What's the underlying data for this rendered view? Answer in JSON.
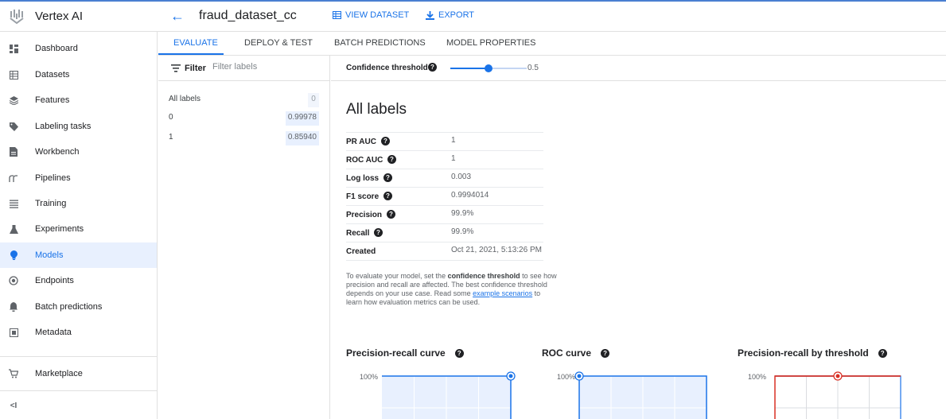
{
  "app": {
    "name": "Vertex AI"
  },
  "header": {
    "back_glyph": "←",
    "model_name": "fraud_dataset_cc",
    "view_dataset_label": "VIEW DATASET",
    "export_label": "EXPORT"
  },
  "sidebar": {
    "items": [
      {
        "label": "Dashboard",
        "icon": "dashboard-icon",
        "active": false
      },
      {
        "label": "Datasets",
        "icon": "datasets-icon",
        "active": false
      },
      {
        "label": "Features",
        "icon": "features-icon",
        "active": false
      },
      {
        "label": "Labeling tasks",
        "icon": "label-tag-icon",
        "active": false
      },
      {
        "label": "Workbench",
        "icon": "notebook-icon",
        "active": false
      },
      {
        "label": "Pipelines",
        "icon": "pipelines-icon",
        "active": false
      },
      {
        "label": "Training",
        "icon": "training-icon",
        "active": false
      },
      {
        "label": "Experiments",
        "icon": "flask-icon",
        "active": false
      },
      {
        "label": "Models",
        "icon": "lightbulb-icon",
        "active": true
      },
      {
        "label": "Endpoints",
        "icon": "endpoints-icon",
        "active": false
      },
      {
        "label": "Batch predictions",
        "icon": "bell-icon",
        "active": false
      },
      {
        "label": "Metadata",
        "icon": "metadata-icon",
        "active": false
      }
    ],
    "marketplace_label": "Marketplace",
    "collapse_glyph": "<I"
  },
  "tabs": [
    {
      "label": "EVALUATE",
      "active": true
    },
    {
      "label": "DEPLOY & TEST",
      "active": false
    },
    {
      "label": "BATCH PREDICTIONS",
      "active": false
    },
    {
      "label": "MODEL PROPERTIES",
      "active": false
    }
  ],
  "filter": {
    "label": "Filter",
    "placeholder": "Filter labels"
  },
  "labels": [
    {
      "name": "All labels",
      "value": "0"
    },
    {
      "name": "0",
      "value": "0.99978"
    },
    {
      "name": "1",
      "value": "0.85940"
    }
  ],
  "confidence": {
    "label": "Confidence threshold",
    "value": 0.5,
    "value_text": "0.5",
    "help_glyph": "?"
  },
  "section_title": "All labels",
  "metrics": [
    {
      "name": "PR AUC",
      "value": "1",
      "help": true
    },
    {
      "name": "ROC AUC",
      "value": "1",
      "help": true
    },
    {
      "name": "Log loss",
      "value": "0.003",
      "help": true
    },
    {
      "name": "F1 score",
      "value": "0.9994014",
      "help": true
    },
    {
      "name": "Precision",
      "value": "99.9%",
      "help": true
    },
    {
      "name": "Recall",
      "value": "99.9%",
      "help": true
    },
    {
      "name": "Created",
      "value": "Oct 21, 2021, 5:13:26 PM",
      "help": false
    }
  ],
  "description": {
    "part1": "To evaluate your model, set the ",
    "bold": "confidence threshold",
    "part2": " to see how precision and recall are affected. The best confidence threshold depends on your use case. Read some ",
    "link": "example scenarios",
    "part3": " to learn how evaluation metrics can be used."
  },
  "charts": [
    {
      "title": "Precision-recall curve",
      "y_tick": "100%"
    },
    {
      "title": "ROC curve",
      "y_tick": "100%"
    },
    {
      "title": "Precision-recall by threshold",
      "y_tick": "100%"
    }
  ],
  "colors": {
    "accent": "#1a73e8",
    "threshold_red": "#d93025",
    "active_bg": "#e8f0fe"
  }
}
